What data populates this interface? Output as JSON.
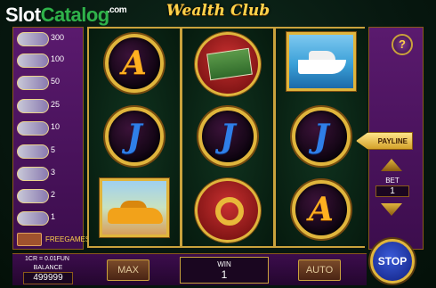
{
  "watermark": {
    "part1": "Slot",
    "part2": "Catalog",
    "part3": ".com"
  },
  "game_title": "Wealth Club",
  "paytable": {
    "values": [
      "300",
      "100",
      "50",
      "25",
      "10",
      "5",
      "3",
      "2",
      "1"
    ],
    "freegames_label": "FREEGAMES"
  },
  "reels": {
    "columns": [
      [
        "A-symbol",
        "J-symbol",
        "sports-car-symbol"
      ],
      [
        "cash-stack-symbol",
        "J-symbol",
        "gold-ring-symbol"
      ],
      [
        "yacht-symbol",
        "J-symbol",
        "A-symbol"
      ]
    ],
    "letters": {
      "A": "A",
      "J": "J"
    }
  },
  "controls": {
    "help_label": "?",
    "payline_label": "PAYLINE",
    "bet_label": "BET",
    "bet_value": "1",
    "stop_label": "STOP",
    "max_label": "MAX",
    "auto_label": "AUTO"
  },
  "bottom": {
    "cr_info": "1CR = 0.01FUN",
    "balance_label": "BALANCE",
    "balance_value": "499999",
    "win_label": "WIN",
    "win_value": "1"
  },
  "colors": {
    "accent_gold": "#e0b53c",
    "panel_purple": "#5a1a6e",
    "stop_blue": "#3a5ad8"
  }
}
